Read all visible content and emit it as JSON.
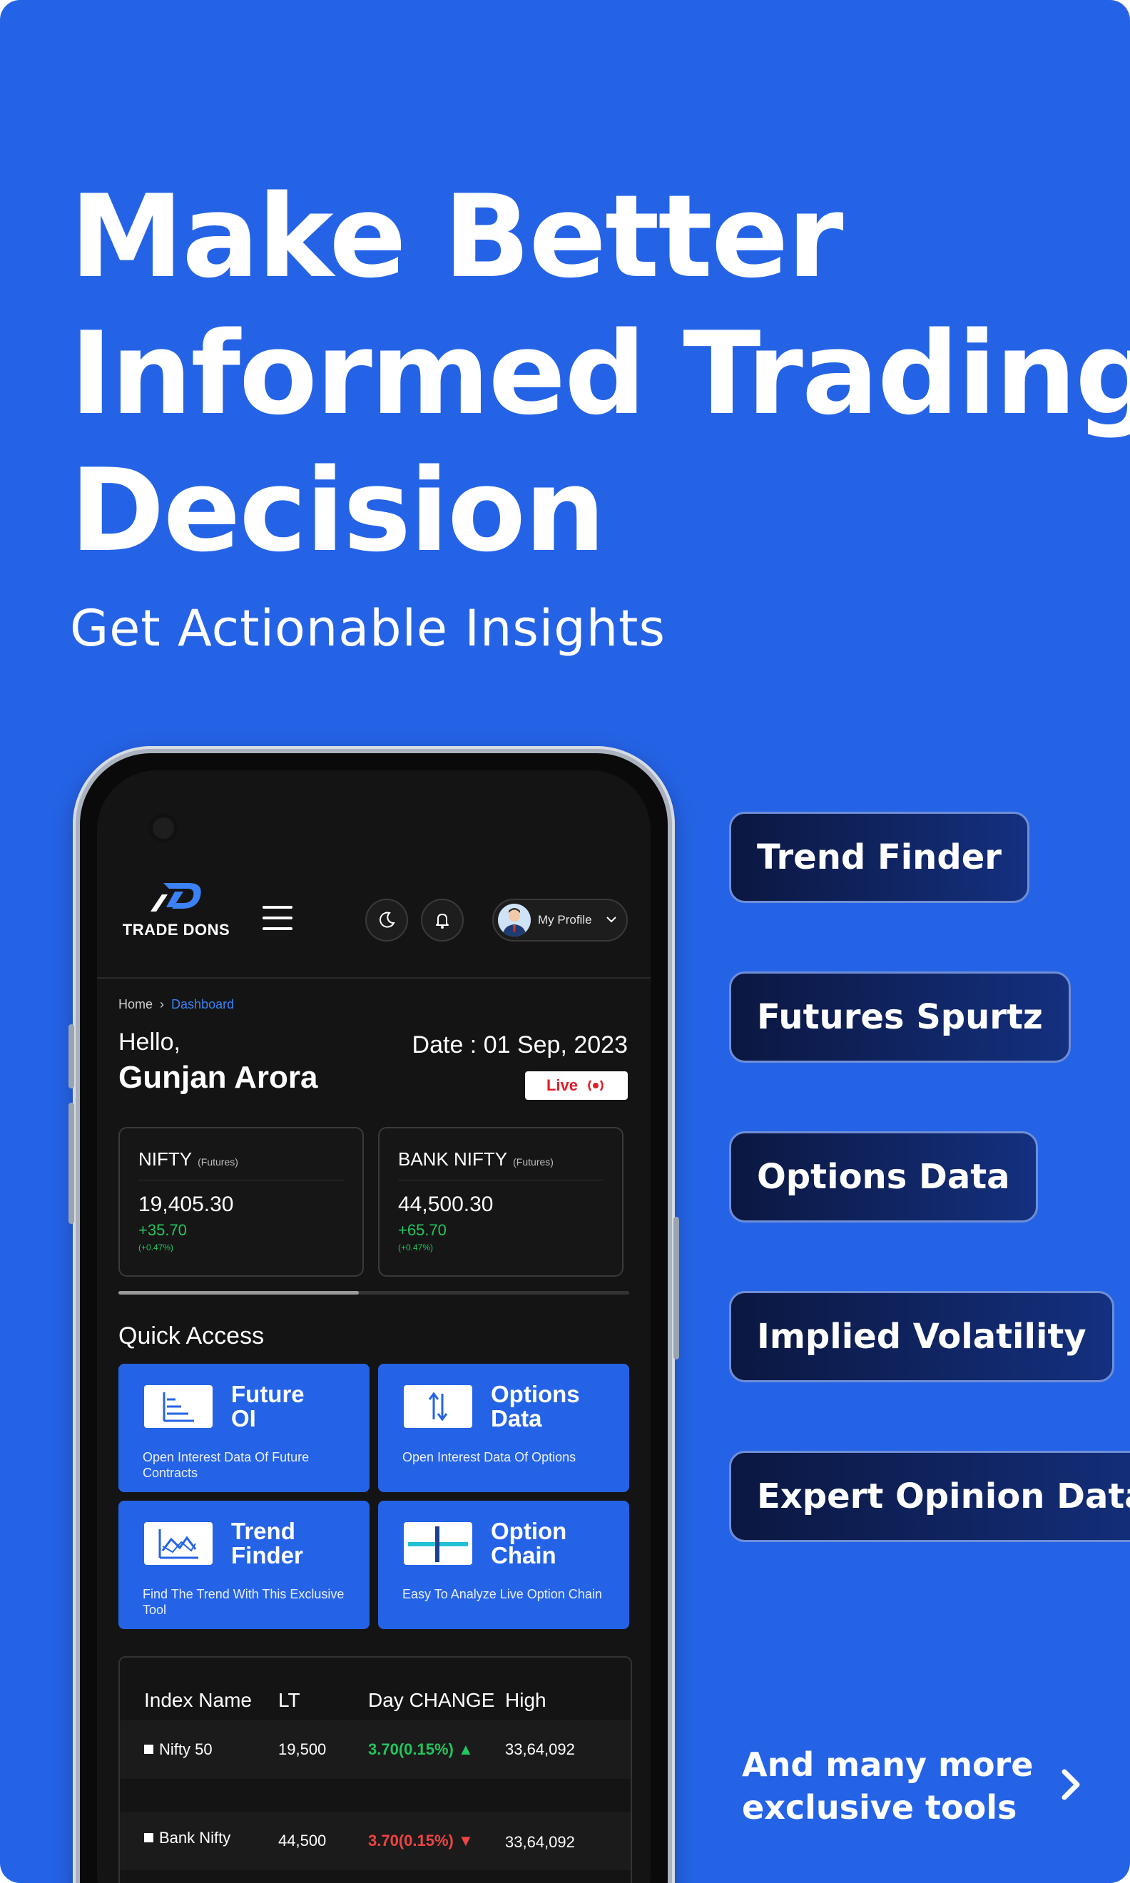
{
  "hero": {
    "headline": [
      "Make Better",
      "Informed Trading",
      "Decision"
    ],
    "subheadline": "Get Actionable Insights"
  },
  "features": [
    "Trend Finder",
    "Futures Spurtz",
    "Options Data",
    "Implied Volatility",
    "Expert Opinion Data"
  ],
  "more": {
    "line1": "And many more",
    "line2": "exclusive tools"
  },
  "app": {
    "logo_text": "TRADE DONS",
    "profile_label": "My Profile",
    "breadcrumb": {
      "home": "Home",
      "current": "Dashboard"
    },
    "greeting": "Hello,",
    "user_name": "Gunjan Arora",
    "date": "Date : 01 Sep, 2023",
    "live_label": "Live",
    "indices": [
      {
        "name": "NIFTY",
        "tag": "(Futures)",
        "value": "19,405.30",
        "change": "+35.70",
        "pct": "(+0.47%)"
      },
      {
        "name": "BANK NIFTY",
        "tag": "(Futures)",
        "value": "44,500.30",
        "change": "+65.70",
        "pct": "(+0.47%)"
      }
    ],
    "scroll_progress": 0.47,
    "quick_access_title": "Quick Access",
    "quick_access": [
      {
        "title1": "Future",
        "title2": "OI",
        "desc": "Open Interest Data Of Future Contracts",
        "icon": "bar-chart-icon"
      },
      {
        "title1": "Options",
        "title2": "Data",
        "desc": "Open Interest Data Of Options",
        "icon": "up-down-arrows-icon"
      },
      {
        "title1": "Trend",
        "title2": "Finder",
        "desc": "Find The Trend With This Exclusive Tool",
        "icon": "line-chart-icon"
      },
      {
        "title1": "Option",
        "title2": "Chain",
        "desc": "Easy To Analyze Live Option Chain",
        "icon": "option-chain-icon"
      }
    ],
    "table": {
      "headers": [
        "Index Name",
        "LT",
        "Day CHANGE",
        "High"
      ],
      "rows": [
        {
          "name": "Nifty 50",
          "lt": "19,500",
          "change": "3.70(0.15%)",
          "direction": "up",
          "high": "33,64,092"
        },
        {
          "name": "Bank Nifty",
          "lt": "44,500",
          "change": "3.70(0.15%)",
          "direction": "down",
          "high": "33,64,092"
        }
      ]
    }
  },
  "colors": {
    "background": "#2563e6",
    "up": "#22c55e",
    "down": "#ef4444",
    "pill": "#0b1740"
  }
}
